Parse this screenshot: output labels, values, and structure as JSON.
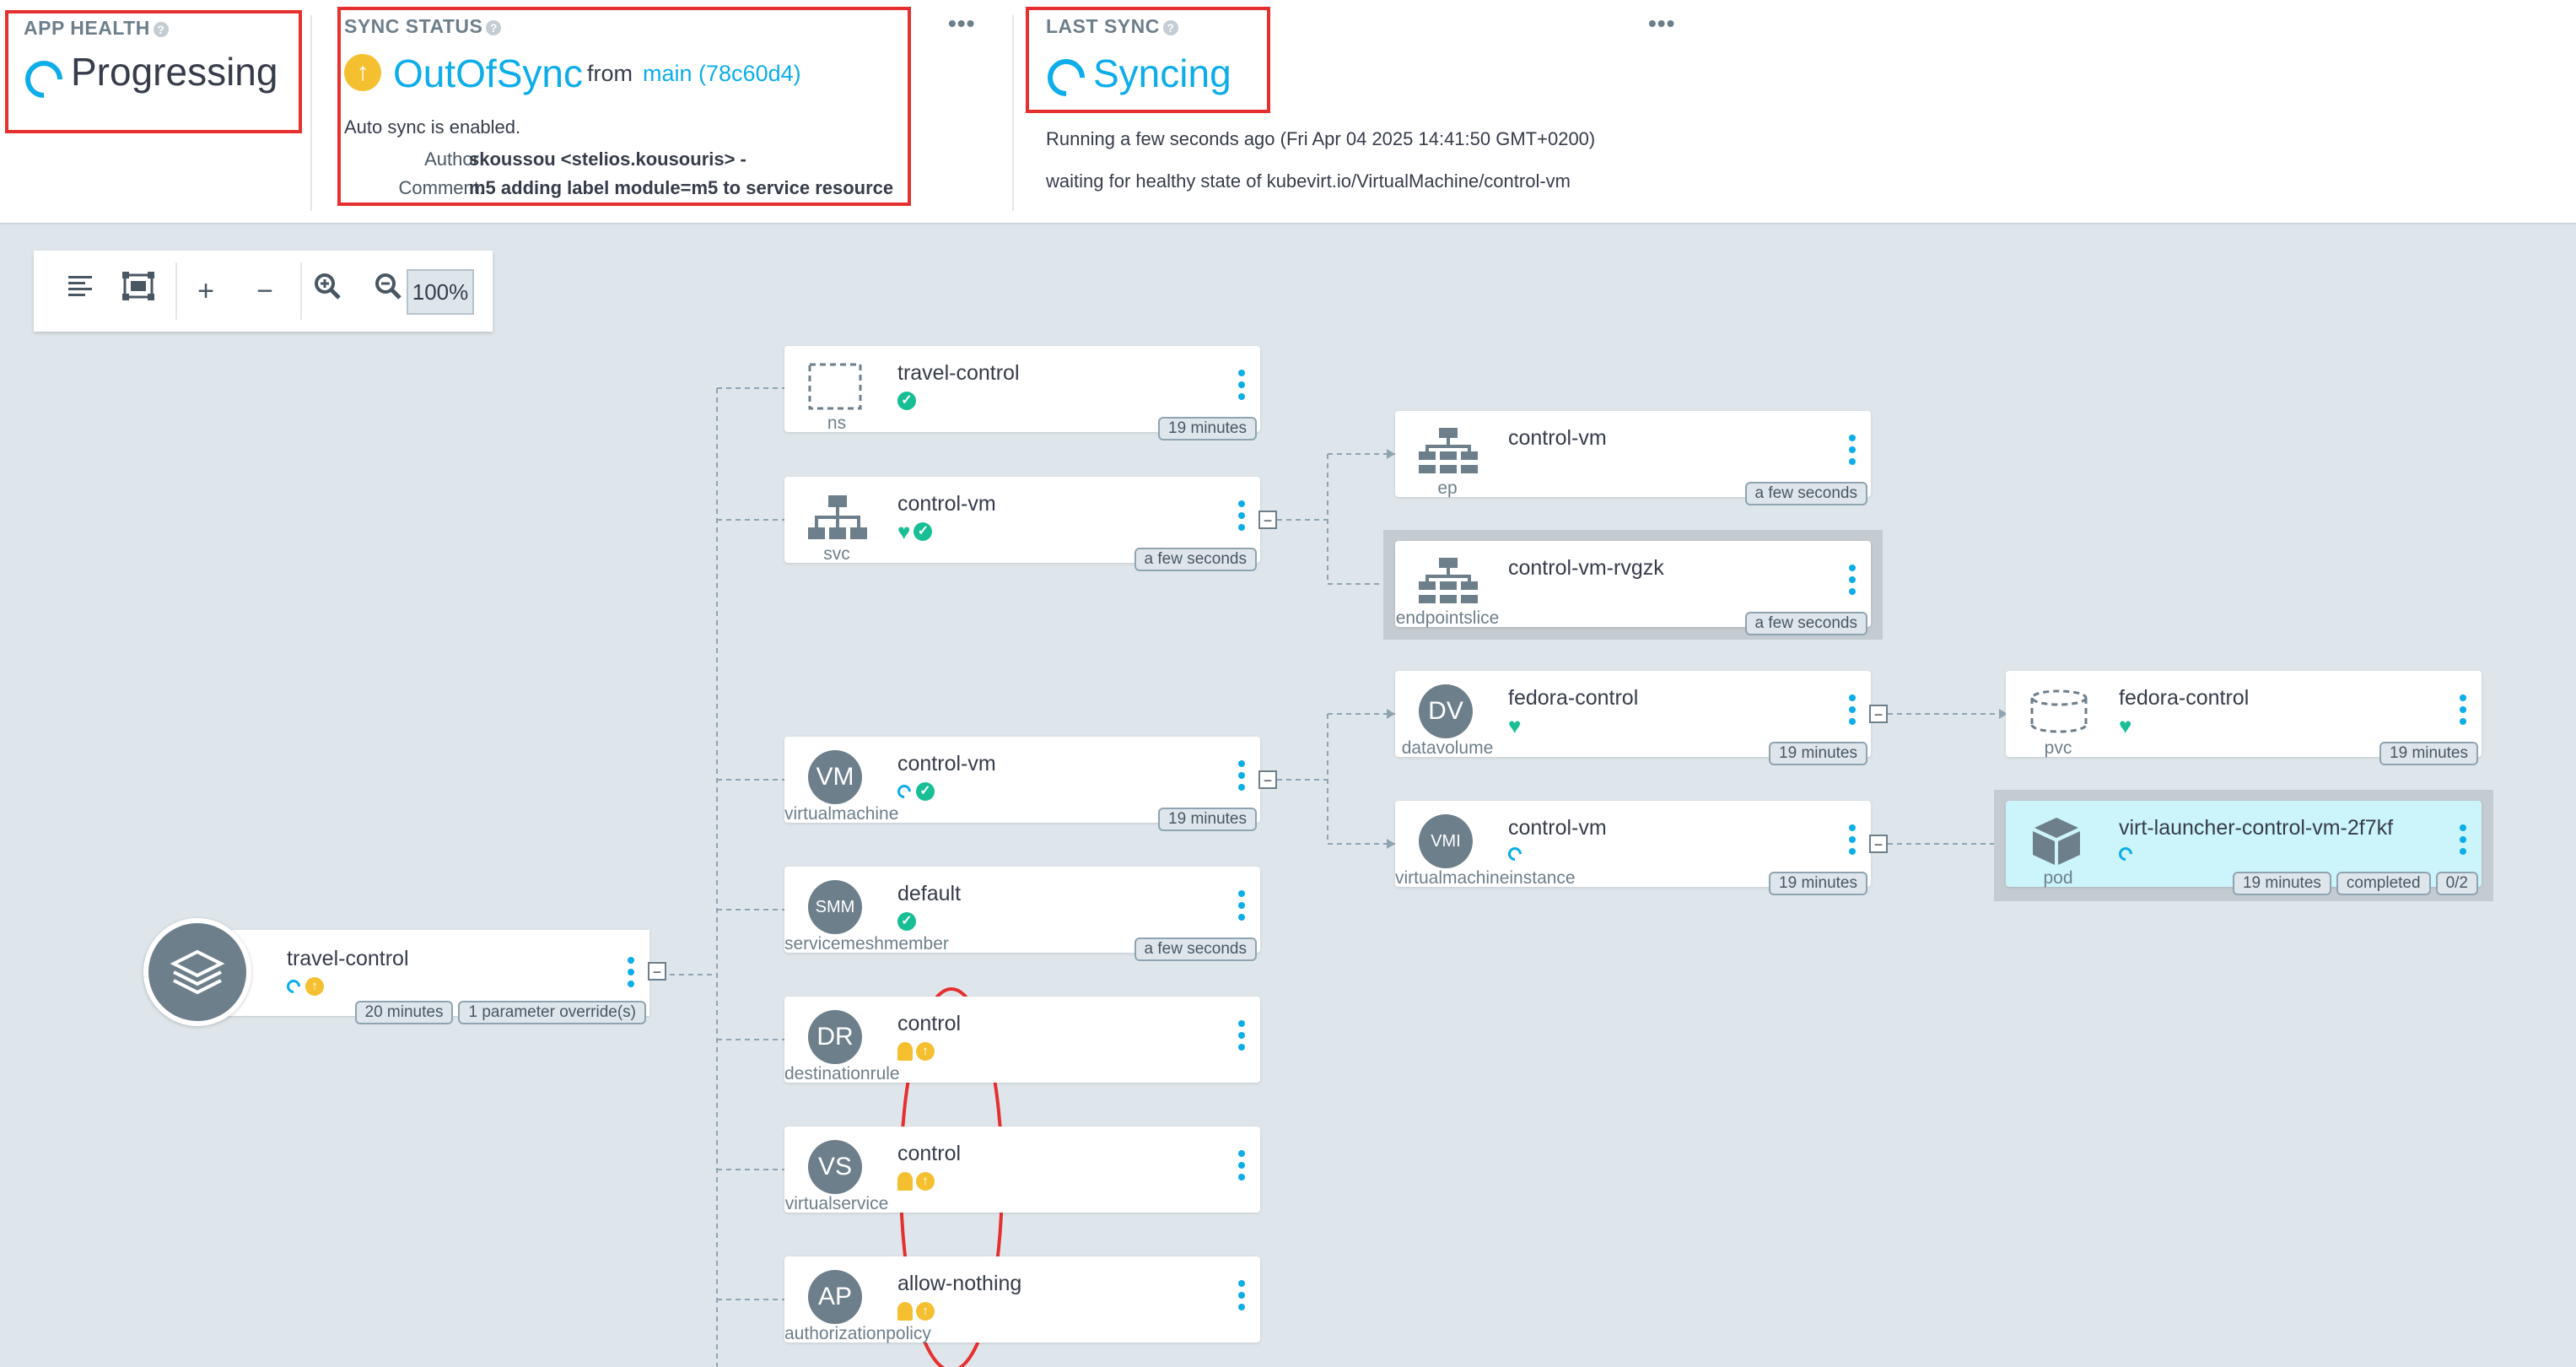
{
  "header": {
    "app_health": {
      "title": "APP HEALTH",
      "help": "?",
      "status": "Progressing"
    },
    "sync_status": {
      "title": "SYNC STATUS",
      "help": "?",
      "status": "OutOfSync",
      "from_label": "from",
      "revision": "main (78c60d4)",
      "auto_sync": "Auto sync is enabled.",
      "author_label": "Author:",
      "author": "skoussou <stelios.kousouris> -",
      "comment_label": "Comment:",
      "comment": "m5 adding label module=m5 to service resource",
      "more": "•••"
    },
    "last_sync": {
      "title": "LAST SYNC",
      "help": "?",
      "status": "Syncing",
      "running": "Running a few seconds ago (Fri Apr 04 2025 14:41:50 GMT+0200)",
      "waiting": "waiting for healthy state of kubevirt.io/VirtualMachine/control-vm",
      "more": "•••"
    }
  },
  "toolbar": {
    "zoom": "100%",
    "plus": "+",
    "minus": "−"
  },
  "app": {
    "name": "travel-control",
    "chips": [
      "20 minutes",
      "1 parameter override(s)"
    ],
    "collapse": "−"
  },
  "nodes": [
    {
      "name": "travel-control",
      "kind": "ns",
      "chips": [
        "19 minutes"
      ]
    },
    {
      "name": "control-vm",
      "kind": "svc",
      "chips": [
        "a few seconds"
      ],
      "collapse": "−"
    },
    {
      "name": "control-vm",
      "kind": "virtualmachine",
      "icon_text": "VM",
      "chips": [
        "19 minutes"
      ],
      "collapse": "−"
    },
    {
      "name": "default",
      "kind": "servicemeshmember",
      "icon_text": "SMM",
      "chips": [
        "a few seconds"
      ]
    },
    {
      "name": "control",
      "kind": "destinationrule",
      "icon_text": "DR",
      "chips": []
    },
    {
      "name": "control",
      "kind": "virtualservice",
      "icon_text": "VS",
      "chips": []
    },
    {
      "name": "allow-nothing",
      "kind": "authorizationpolicy",
      "icon_text": "AP",
      "chips": []
    },
    {
      "name": "control-vm",
      "kind": "ep",
      "chips": [
        "a few seconds"
      ]
    },
    {
      "name": "control-vm-rvgzk",
      "kind": "endpointslice",
      "chips": [
        "a few seconds"
      ]
    },
    {
      "name": "fedora-control",
      "kind": "datavolume",
      "icon_text": "DV",
      "chips": [
        "19 minutes"
      ],
      "collapse": "−"
    },
    {
      "name": "control-vm",
      "kind": "virtualmachineinstance",
      "icon_text": "VMI",
      "chips": [
        "19 minutes"
      ],
      "collapse": "−"
    },
    {
      "name": "fedora-control",
      "kind": "pvc",
      "chips": [
        "19 minutes"
      ]
    },
    {
      "name": "virt-launcher-control-vm-2f7kf",
      "kind": "pod",
      "chips": [
        "19 minutes",
        "completed",
        "0/2"
      ]
    }
  ],
  "status_glyphs": {
    "check": "✓",
    "heart": "♥",
    "up": "↑"
  },
  "colors": {
    "accent": "#0dadea",
    "healthy": "#18be94",
    "outofsync": "#f4c030",
    "annotation": "#e6302f"
  }
}
